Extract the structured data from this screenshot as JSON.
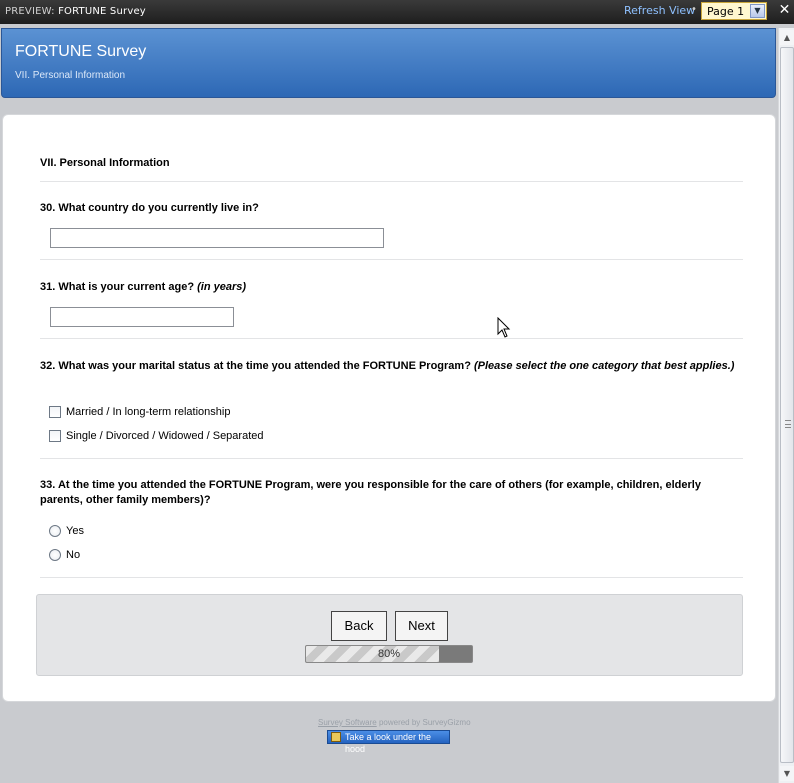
{
  "topbar": {
    "preview_prefix": "PREVIEW:",
    "survey_name": "FORTUNE Survey",
    "refresh_label": "Refresh View",
    "separator": "•",
    "page_select_value": "Page 1",
    "close_label": "✕"
  },
  "header": {
    "title": "FORTUNE Survey",
    "subtitle": "VII. Personal Information"
  },
  "section": {
    "title": "VII. Personal Information"
  },
  "questions": {
    "q30": {
      "text": "30. What country do you currently live in?",
      "value": ""
    },
    "q31": {
      "text": "31. What is your current age?",
      "hint": "(in years)",
      "value": ""
    },
    "q32": {
      "text": "32. What was your marital status at the time you attended the FORTUNE Program?",
      "hint": "(Please select the one category that best applies.)",
      "options": [
        "Married / In long-term relationship",
        "Single / Divorced / Widowed / Separated"
      ]
    },
    "q33": {
      "text": "33. At the time you attended the FORTUNE Program, were you responsible for the care of others (for example, children, elderly parents, other family members)?",
      "options": [
        "Yes",
        "No"
      ]
    }
  },
  "nav": {
    "back_label": "Back",
    "next_label": "Next",
    "progress_fraction": 0.8,
    "progress_text": "80%"
  },
  "footer": {
    "powered_link": "Survey Software",
    "powered_text": "powered by SurveyGizmo",
    "hood_label": "Take a look under the hood"
  },
  "colors": {
    "header_blue": "#3b76c2",
    "topbar_dark": "#2a2a2a",
    "page_select_bg": "#fff8d0"
  },
  "icons": {
    "close": "close-icon",
    "dropdown": "chevron-down-icon",
    "cursor": "mouse-pointer-icon"
  }
}
